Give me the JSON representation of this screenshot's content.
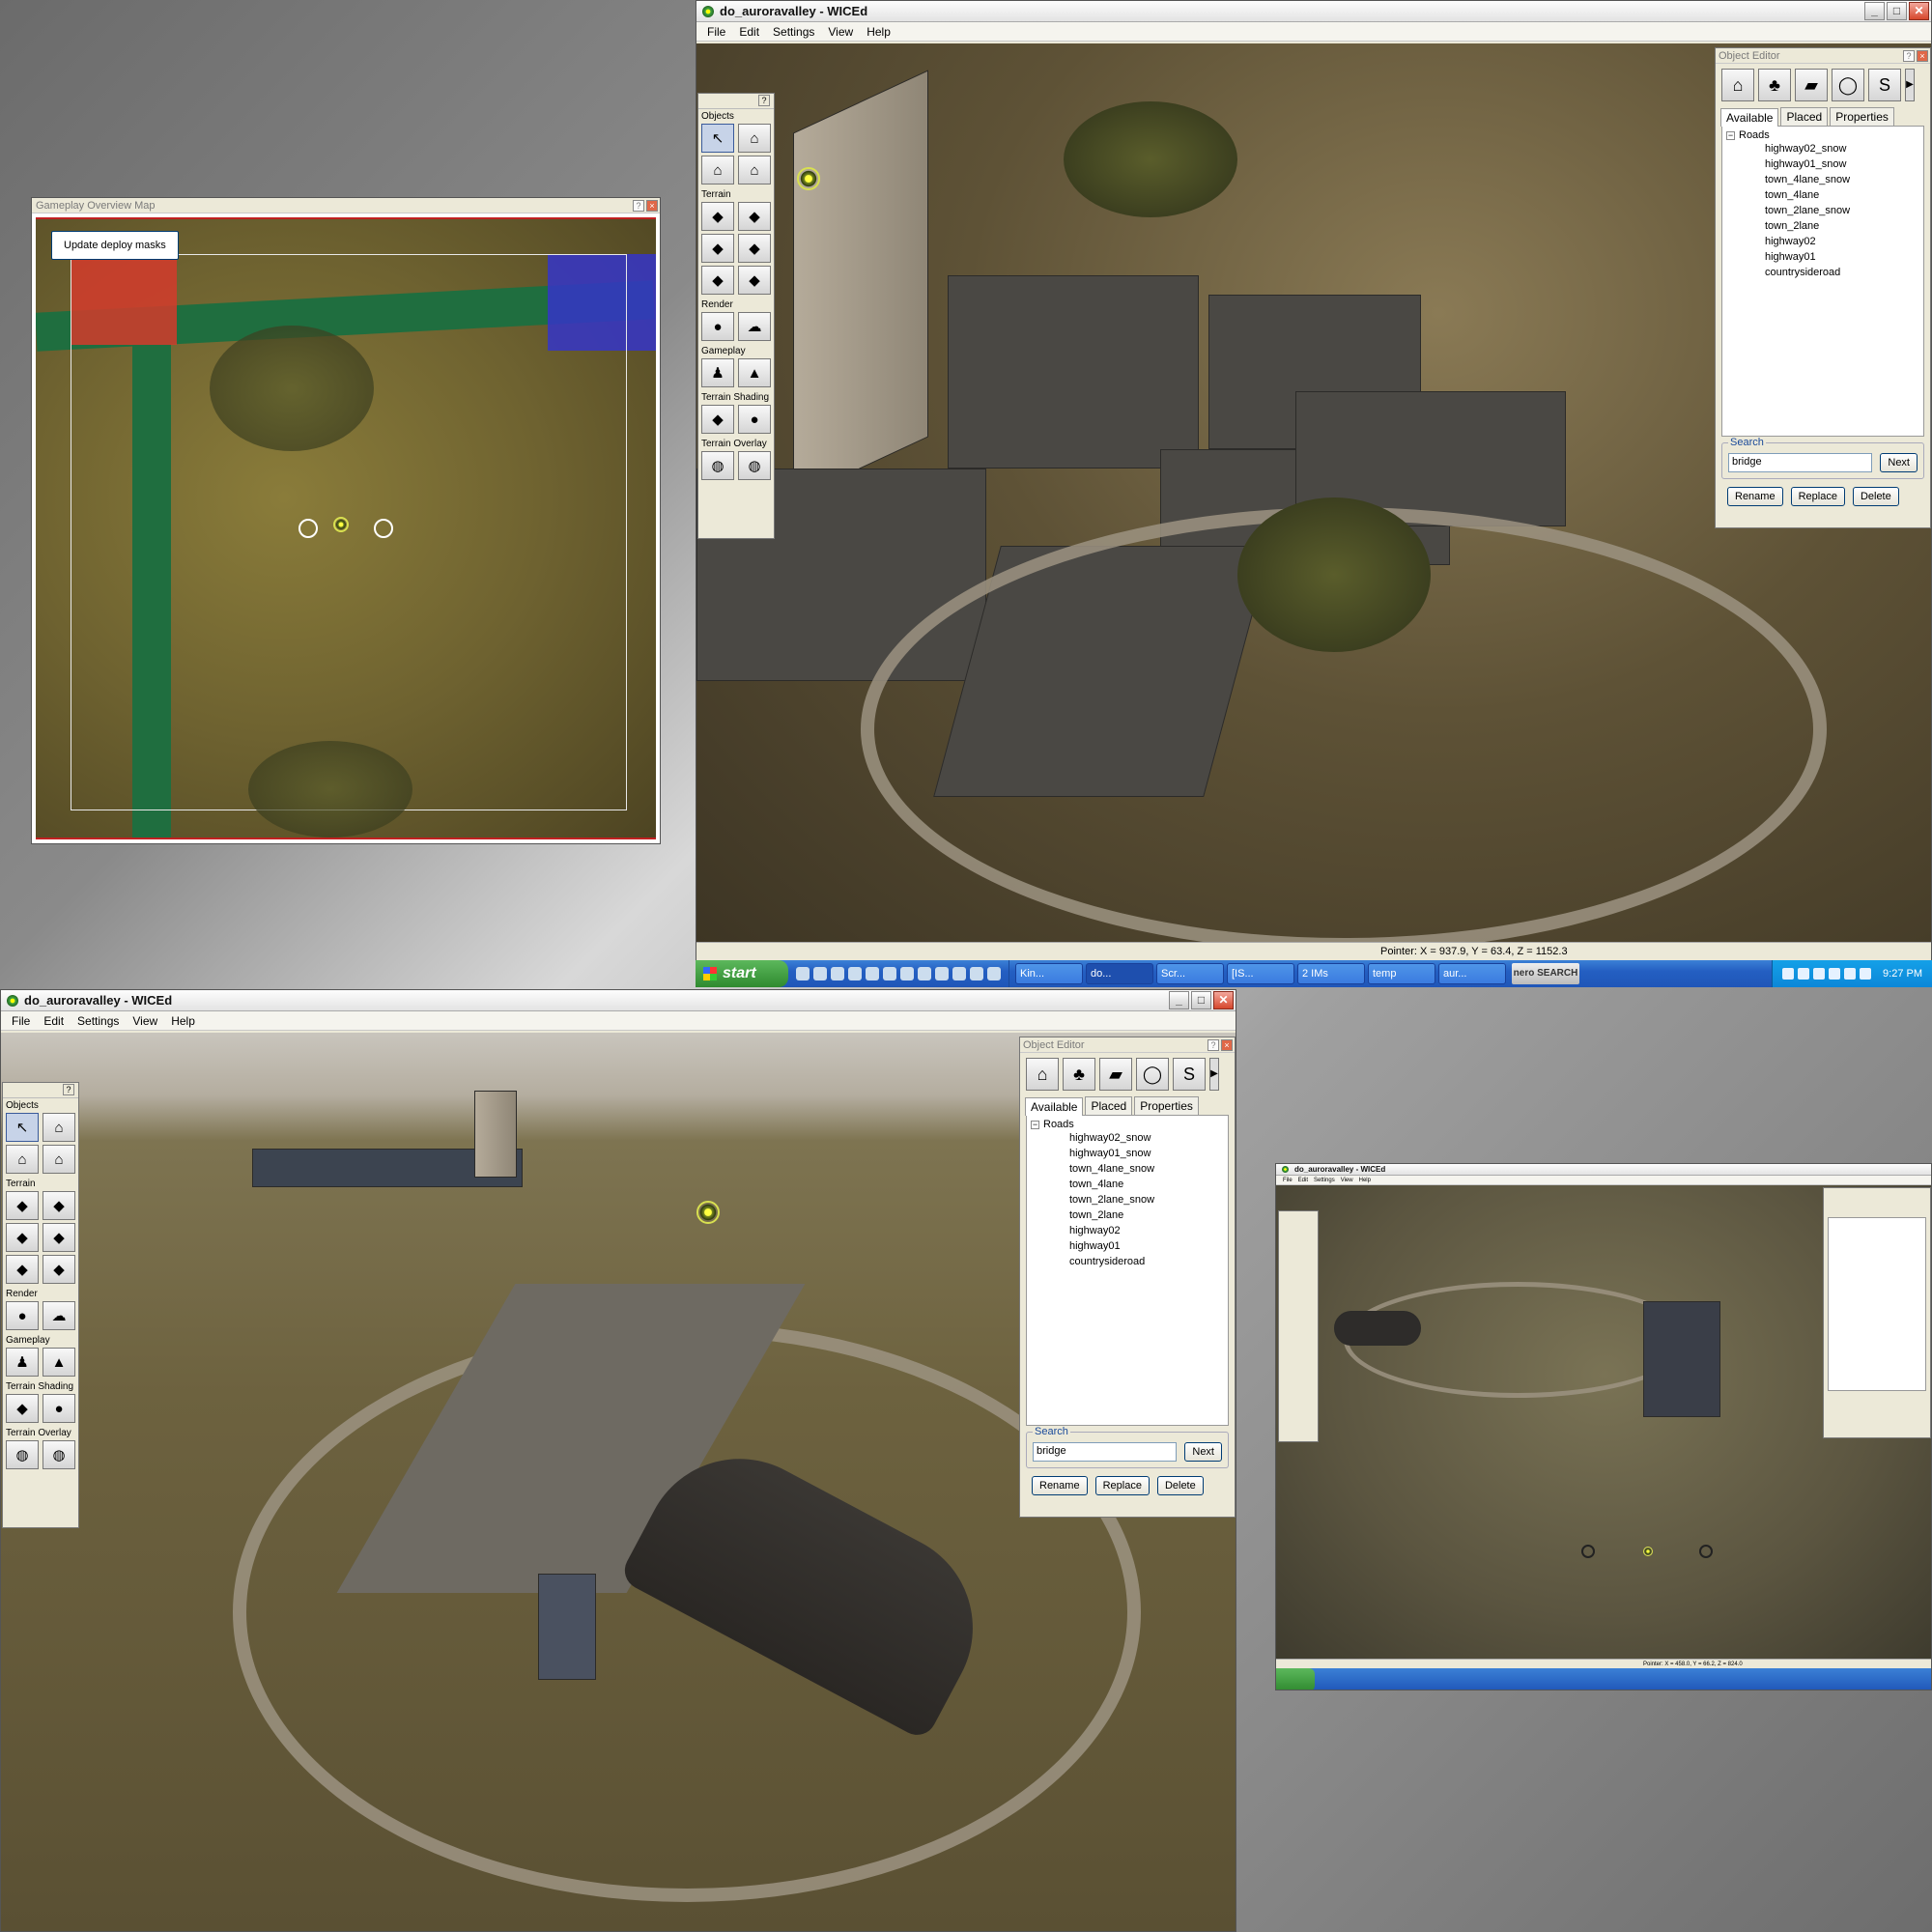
{
  "window_top": {
    "title": "do_auroravalley - WICEd",
    "menu": [
      "File",
      "Edit",
      "Settings",
      "View",
      "Help"
    ],
    "status": "Pointer: X = 937.9, Y = 63.4, Z = 1152.3"
  },
  "window_bottom": {
    "title": "do_auroravalley - WICEd",
    "menu": [
      "File",
      "Edit",
      "Settings",
      "View",
      "Help"
    ]
  },
  "window_thumb": {
    "title": "do_auroravalley - WICEd",
    "menu": [
      "File",
      "Edit",
      "Settings",
      "View",
      "Help"
    ],
    "status": "Pointer: X = 458.0, Y = 66.2, Z = 824.0"
  },
  "overview_map": {
    "title": "Gameplay Overview Map",
    "update_button": "Update deploy masks"
  },
  "tool_palette": {
    "q": "?",
    "sections": {
      "objects": "Objects",
      "terrain": "Terrain",
      "render": "Render",
      "gameplay": "Gameplay",
      "terrain_shading": "Terrain Shading",
      "terrain_overlay": "Terrain Overlay"
    }
  },
  "object_editor": {
    "title": "Object Editor",
    "tabs": [
      "Available",
      "Placed",
      "Properties"
    ],
    "tree_root": "Roads",
    "tree_items": [
      "highway02_snow",
      "highway01_snow",
      "town_4lane_snow",
      "town_4lane",
      "town_2lane_snow",
      "town_2lane",
      "highway02",
      "highway01",
      "countrysideroad"
    ],
    "search_label": "Search",
    "search_value": "bridge",
    "next": "Next",
    "rename": "Rename",
    "replace": "Replace",
    "delete": "Delete"
  },
  "taskbar": {
    "start": "start",
    "tasks": [
      "Kin...",
      "do...",
      "Scr...",
      "[IS...",
      "2 IMs",
      "temp",
      "aur..."
    ],
    "nero": "nero SEARCH",
    "clock": "9:27 PM"
  },
  "colors": {
    "accent": "#245fc2",
    "deploy_red": "#d33b2c",
    "deploy_blue": "#3535c8",
    "river": "#1f6e3f"
  }
}
